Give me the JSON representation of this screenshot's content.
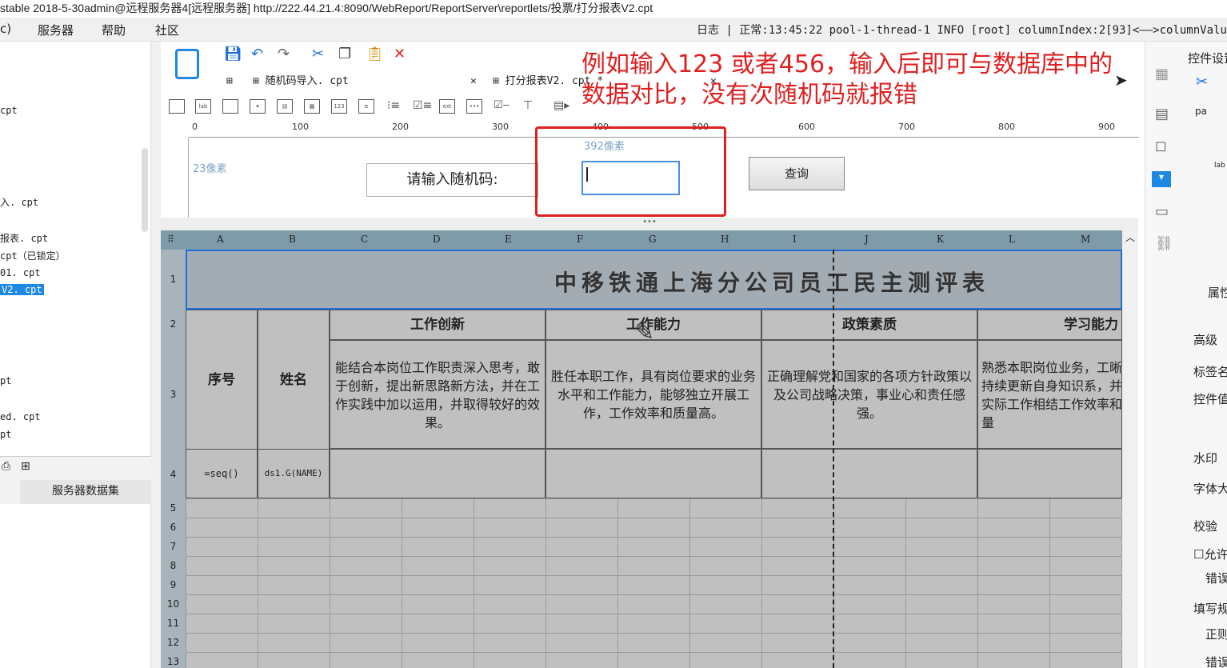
{
  "window_title": "stable 2018-5-30admin@远程服务器4[远程服务器]    http://222.44.21.4:8090/WebReport/ReportServer\\reportlets/投票/打分报表V2.cpt",
  "menu": {
    "item0": "c)",
    "server": "服务器",
    "help": "帮助",
    "community": "社区"
  },
  "log_text": "日志 | 正常:13:45:22 pool-1-thread-1 INFO [root] columnIndex:2[93]<——>columnValue:2020-0",
  "left_files": [
    "cpt",
    "入. cpt",
    "报表. cpt",
    " cpt（已锁定）",
    "01. cpt",
    "V2. cpt",
    "pt",
    "ed. cpt",
    "pt"
  ],
  "server_dataset": "服务器数据集",
  "tabs": {
    "tab1": "随机码导入. cpt",
    "tab2": "打分报表V2. cpt *"
  },
  "ruler_ticks": [
    "0",
    "100",
    "200",
    "300",
    "400",
    "500",
    "600",
    "700",
    "800",
    "900"
  ],
  "param": {
    "size_23": "23像素",
    "size_392": "392像素",
    "label": "请输入随机码:",
    "query_button": "查询"
  },
  "annotation": {
    "line1": "例如输入123    或者456，输入后即可与数据库中的",
    "line2": "数据对比，没有次随机码就报错"
  },
  "columns": [
    "A",
    "B",
    "C",
    "D",
    "E",
    "F",
    "G",
    "H",
    "I",
    "J",
    "K",
    "L",
    "M"
  ],
  "rows": [
    "1",
    "2",
    "3",
    "4",
    "5",
    "6",
    "7",
    "8",
    "9",
    "10",
    "11",
    "12",
    "13"
  ],
  "sheet": {
    "title": "中移铁通上海分公司员工民主测评表",
    "seq_header": "序号",
    "name_header": "姓名",
    "cat1": "工作创新",
    "cat2": "工作能力",
    "cat3": "政策素质",
    "cat4": "学习能力",
    "desc1": "能结合本岗位工作职责深入思考，敢于创新，提出新思路新方法，并在工作实践中加以运用，并取得较好的效果。",
    "desc2": "胜任本职工作，具有岗位要求的业务水平和工作能力，能够独立开展工作，工作效率和质量高。",
    "desc3": "正确理解党和国家的各项方针政策以及公司战略决策，事业心和责任感强。",
    "desc4": "熟悉本职岗位业务，工晰；持续更新自身知识系，并与实际工作相结工作效率和质量",
    "formula_seq": "=seq()",
    "formula_name": "ds1.G(NAME)"
  },
  "right_panel": {
    "title": "控件设置",
    "pa": "pa",
    "lab": "lab",
    "attr": "属性",
    "adv": "高级",
    "tag": "标签名",
    "ctrlval": "控件值",
    "water": "水印",
    "font": "字体大",
    "check": "校验",
    "allow": "允许",
    "err": "错误",
    "fill": "填写规",
    "regex": "正则",
    "err2": "错误"
  }
}
